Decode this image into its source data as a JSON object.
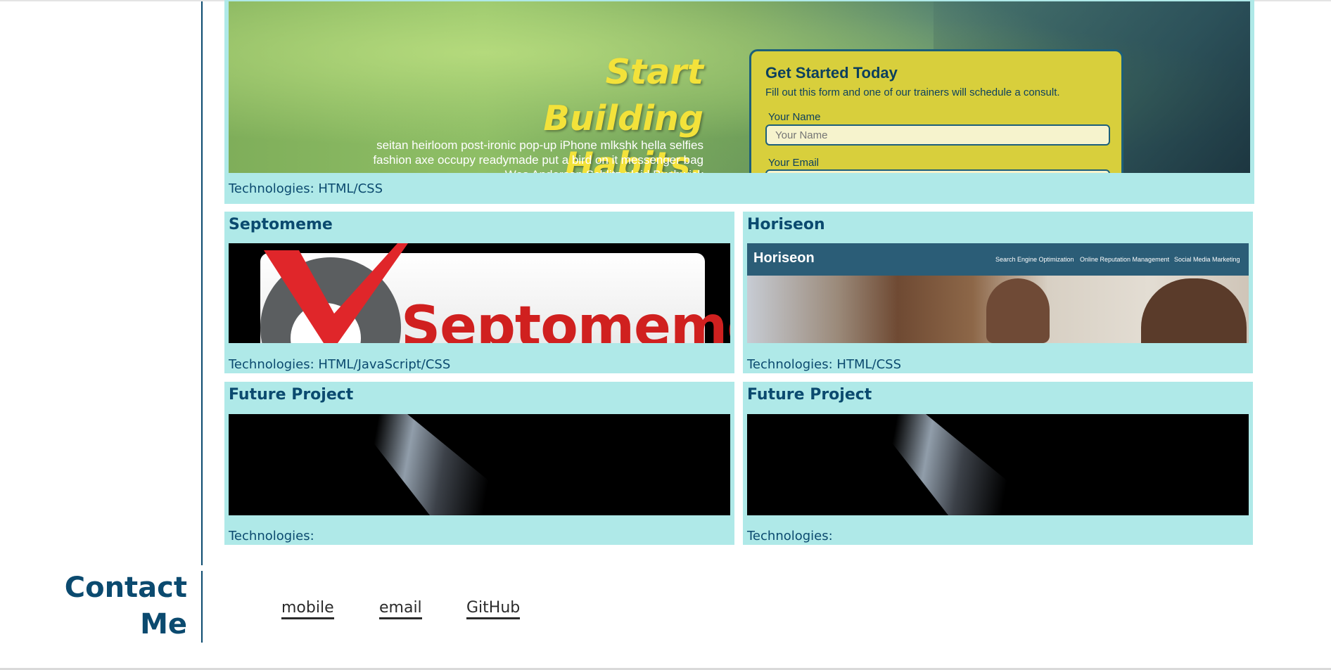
{
  "projects": {
    "featured": {
      "technologies": "Technologies: HTML/CSS",
      "screenshot": {
        "headline_line1": "Start Building",
        "headline_line2": "Habits.",
        "copy": "seitan heirloom post-ironic pop-up iPhone mlkshk hella selfies fashion axe occupy readymade put a bird on it messenger bag Wes Anderson Schlitz plaid Bushwick",
        "form_title": "Get Started Today",
        "form_subtitle": "Fill out this form and one of our trainers will schedule a consult.",
        "name_label": "Your Name",
        "name_placeholder": "Your Name",
        "email_label": "Your Email"
      }
    },
    "items": [
      {
        "title": "Septomeme",
        "technologies": "Technologies: HTML/JavaScript/CSS",
        "screenshot_word": "Septomeme"
      },
      {
        "title": "Horiseon",
        "technologies": "Technologies: HTML/CSS",
        "screenshot": {
          "logo": "Horiseon",
          "nav": [
            "Search Engine Optimization",
            "Online Reputation Management",
            "Social Media Marketing"
          ]
        }
      },
      {
        "title": "Future Project",
        "technologies": "Technologies:"
      },
      {
        "title": "Future Project",
        "technologies": "Technologies:"
      }
    ]
  },
  "contact": {
    "title_line1": "Contact",
    "title_line2": "Me",
    "links": [
      "mobile",
      "email",
      "GitHub"
    ]
  },
  "colors": {
    "card_background": "#afe9e8",
    "heading": "#0b4a6f",
    "divider": "#0b4a6f"
  }
}
